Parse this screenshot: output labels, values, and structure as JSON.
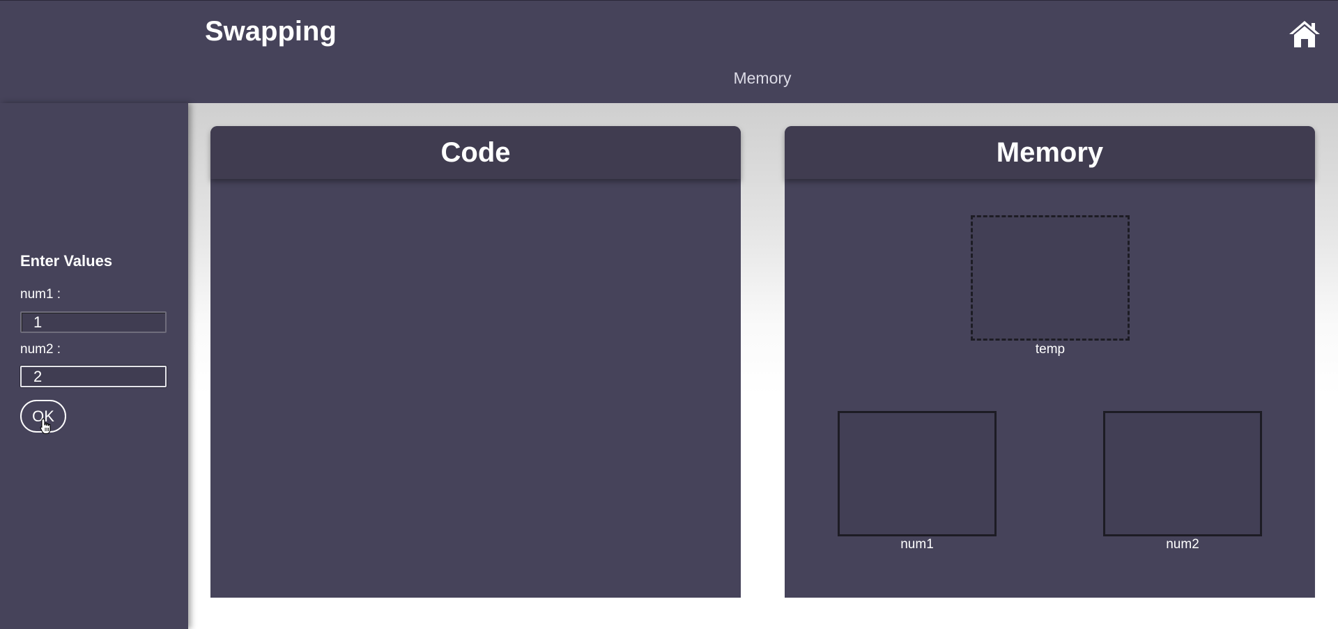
{
  "header": {
    "title": "Swapping",
    "section_label": "Memory",
    "home_icon": "home-icon"
  },
  "sidebar": {
    "heading": "Enter Values",
    "num1_label": "num1 :",
    "num1_value": "1",
    "num2_label": "num2 :",
    "num2_value": "2",
    "ok_label": "OK"
  },
  "code_panel": {
    "title": "Code"
  },
  "memory_panel": {
    "title": "Memory",
    "temp_label": "temp",
    "num1_label": "num1",
    "num2_label": "num2"
  },
  "colors": {
    "background": "#46435a",
    "panel_header": "#403c50",
    "workspace": "#ffffff",
    "text": "#ffffff"
  }
}
